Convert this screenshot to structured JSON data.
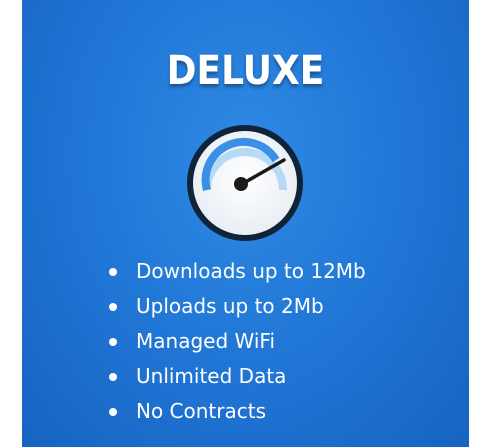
{
  "plan": {
    "name": "DELUXE",
    "icon": "speedometer-icon",
    "features": [
      "Downloads up to 12Mb",
      "Uploads up to 2Mb",
      "Managed WiFi",
      "Unlimited Data",
      "No Contracts"
    ]
  },
  "colors": {
    "card_background": "#1f74d4",
    "text": "#ffffff",
    "gauge_arc": "#3a8fe6"
  }
}
